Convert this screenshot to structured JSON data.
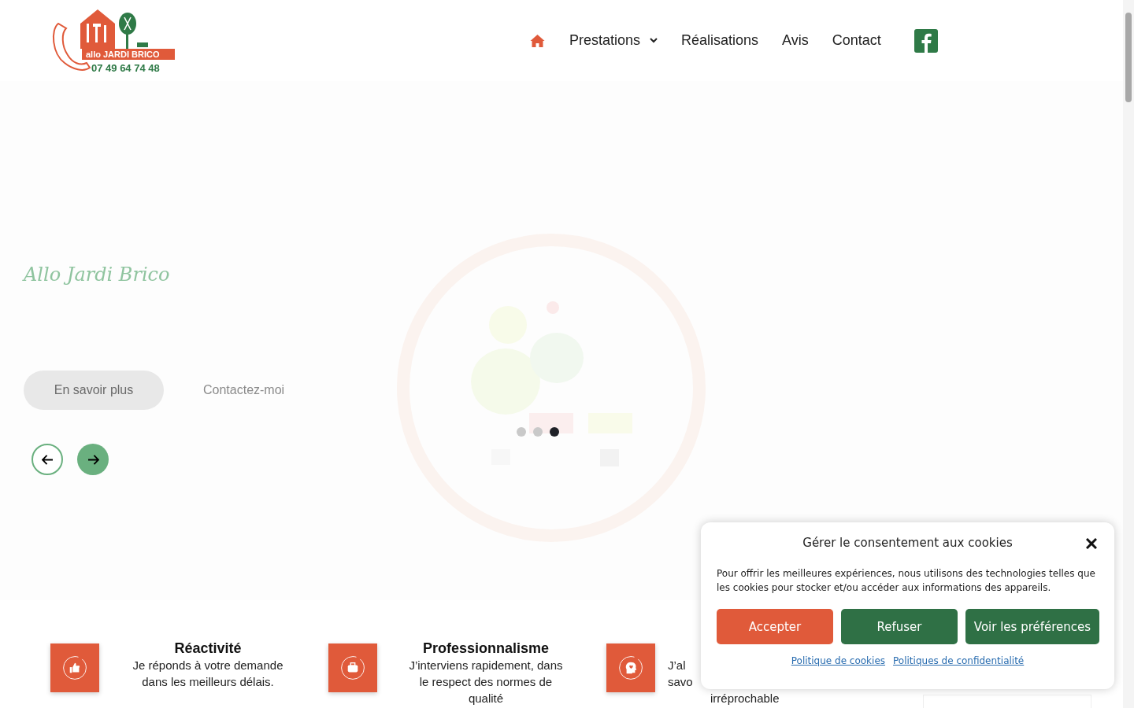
{
  "logo": {
    "brand": "allo JARDI BRICO",
    "phone": "07 49 64 74 48"
  },
  "nav": {
    "items": [
      {
        "label": "Prestations",
        "has_submenu": true
      },
      {
        "label": "Réalisations",
        "has_submenu": false
      },
      {
        "label": "Avis",
        "has_submenu": false
      },
      {
        "label": "Contact",
        "has_submenu": false
      }
    ]
  },
  "hero": {
    "title": "Allo Jardi Brico",
    "primary_button": "En savoir plus",
    "secondary_button": "Contactez-moi",
    "dots": [
      {
        "selected": false
      },
      {
        "selected": false
      },
      {
        "selected": true
      }
    ]
  },
  "features": [
    {
      "title": "Réactivité",
      "lines": [
        "Je réponds à votre demande",
        "dans les meilleurs délais."
      ]
    },
    {
      "title": "Professionnalisme",
      "lines": [
        "J’interviens rapidement, dans",
        "le respect des normes de",
        "qualité"
      ]
    },
    {
      "lines": [
        "J’al",
        "savo",
        "irréprochable"
      ]
    }
  ],
  "cookie_dialog": {
    "title": "Gérer le consentement aux cookies",
    "text": "Pour offrir les meilleures expériences, nous utilisons des technologies telles que les cookies pour stocker et/ou accéder aux informations des appareils.",
    "buttons": [
      {
        "label": "Accepter",
        "kind": "primary"
      },
      {
        "label": "Refuser",
        "kind": "secondary"
      },
      {
        "label": "Voir les préférences",
        "kind": "secondary"
      }
    ],
    "links": [
      "Politique de cookies",
      "Politiques de confidentialité"
    ]
  }
}
